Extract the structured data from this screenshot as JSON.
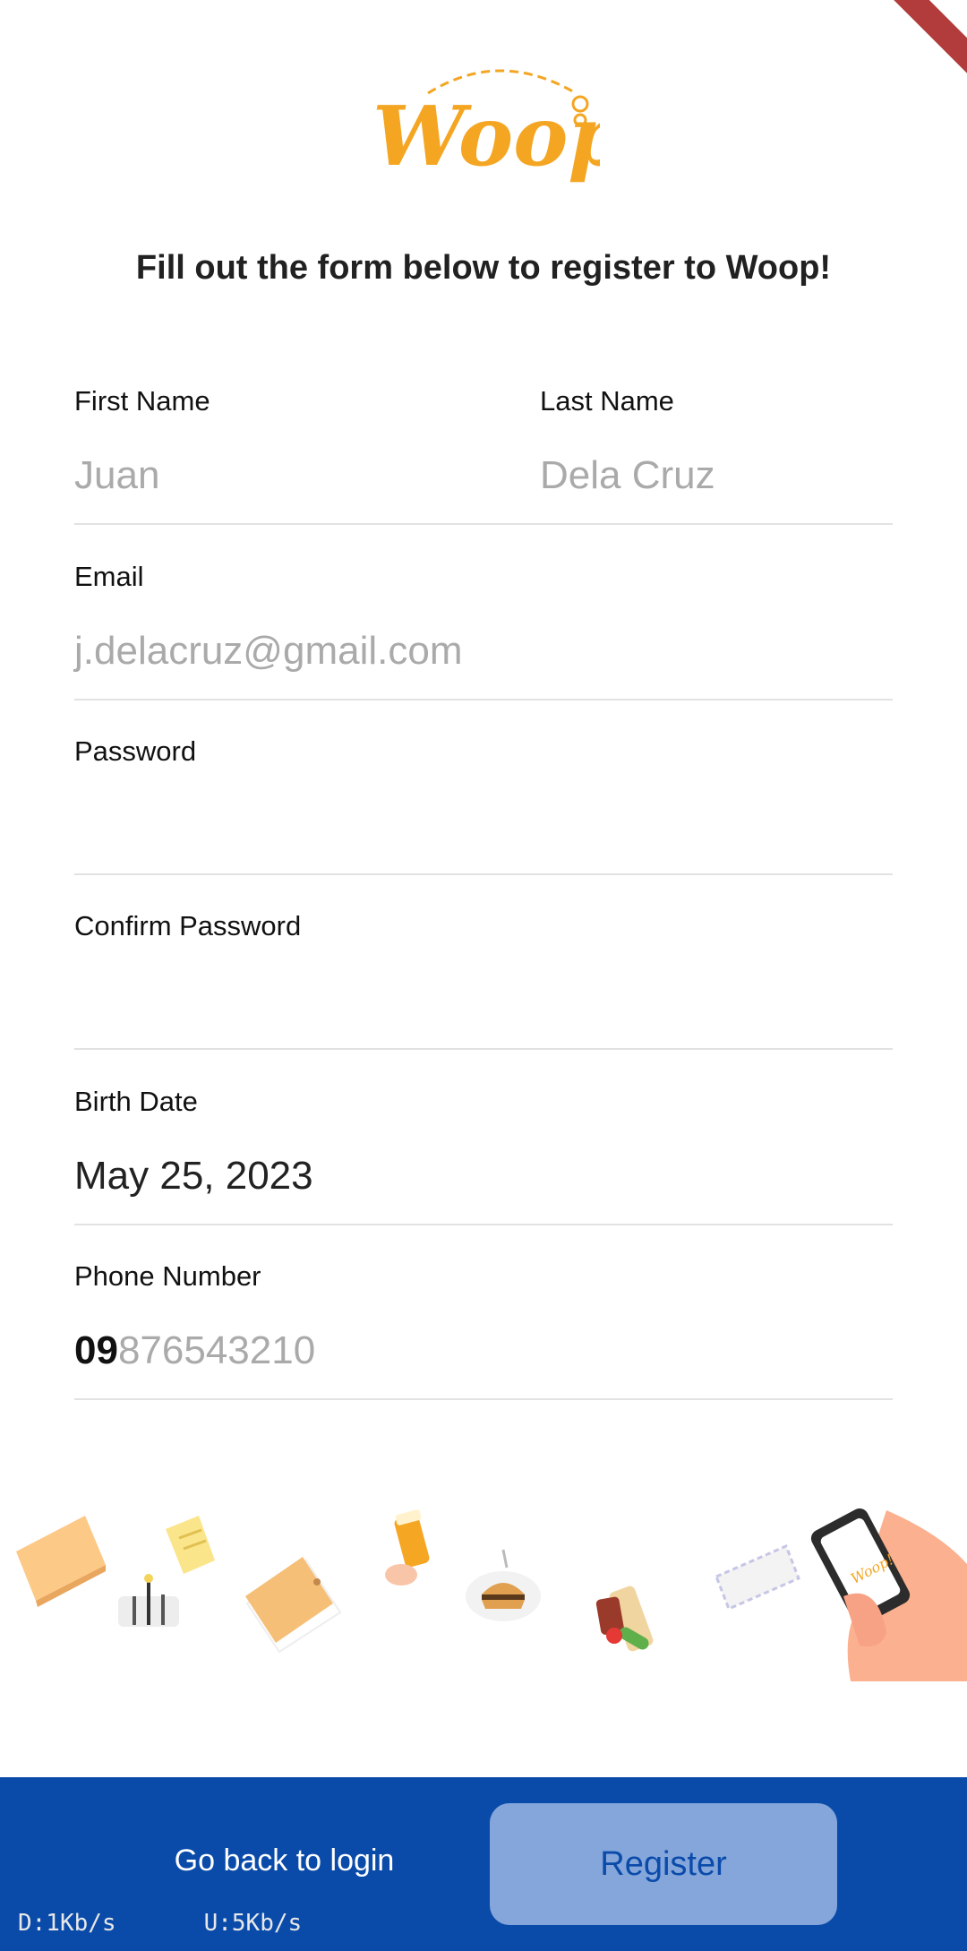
{
  "app": {
    "logo_text": "Woop!",
    "debug_banner": "DEBUG"
  },
  "colors": {
    "brand_orange": "#f4a623",
    "bottom_bar": "#0a4baa",
    "register_bg": "#84a6db",
    "register_text": "#0a4baa"
  },
  "header": {
    "headline": "Fill out the form below to register to Woop!"
  },
  "form": {
    "first_name": {
      "label": "First Name",
      "placeholder": "Juan"
    },
    "last_name": {
      "label": "Last Name",
      "placeholder": "Dela Cruz"
    },
    "email": {
      "label": "Email",
      "placeholder": "j.delacruz@gmail.com"
    },
    "password": {
      "label": "Password",
      "value": ""
    },
    "confirm_password": {
      "label": "Confirm Password",
      "value": ""
    },
    "birth_date": {
      "label": "Birth Date",
      "value": "May 25, 2023"
    },
    "phone": {
      "label": "Phone Number",
      "prefix": "09",
      "placeholder": "876543210"
    }
  },
  "illustration": {
    "items": [
      "package-icon",
      "receipt-icon",
      "tools-icon",
      "box-icon",
      "medicine-icon",
      "burger-icon",
      "groceries-icon",
      "envelope-icon",
      "phone-hand-icon"
    ]
  },
  "footer": {
    "back_label": "Go back to login",
    "register_label": "Register"
  },
  "status": {
    "download": "D:1Kb/s",
    "upload": "U:5Kb/s"
  }
}
